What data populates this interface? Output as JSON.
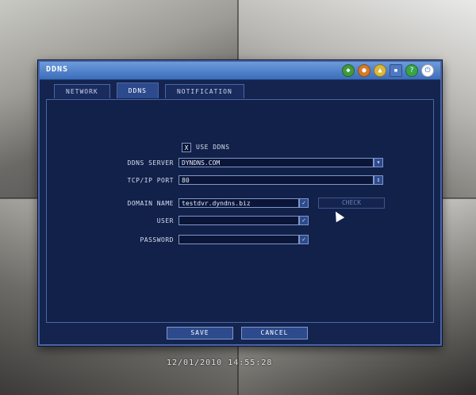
{
  "window": {
    "title": "DDNS",
    "toolbar_icons": [
      "network-icon",
      "record-icon",
      "camera-icon",
      "monitor-icon",
      "help-icon",
      "exit-icon"
    ]
  },
  "tabs": [
    {
      "label": "NETWORK",
      "active": false
    },
    {
      "label": "DDNS",
      "active": true
    },
    {
      "label": "NOTIFICATION",
      "active": false
    }
  ],
  "form": {
    "use_ddns": {
      "label": "USE DDNS",
      "checked": true,
      "mark": "X"
    },
    "ddns_server": {
      "label": "DDNS SERVER",
      "value": "DYNDNS.COM"
    },
    "tcp_port": {
      "label": "TCP/IP PORT",
      "value": "80"
    },
    "domain_name": {
      "label": "DOMAIN NAME",
      "value": "testdvr.dyndns.biz",
      "check_button": "CHECK"
    },
    "user": {
      "label": "USER",
      "value": ""
    },
    "password": {
      "label": "PASSWORD",
      "value": ""
    }
  },
  "buttons": {
    "save": "SAVE",
    "cancel": "CANCEL"
  },
  "overlay": {
    "timestamp": "12/01/2010 14:55:28"
  },
  "colors": {
    "dialog_bg": "#14244f",
    "titlebar": "#3b6cb8",
    "accent": "#7f97c9"
  }
}
